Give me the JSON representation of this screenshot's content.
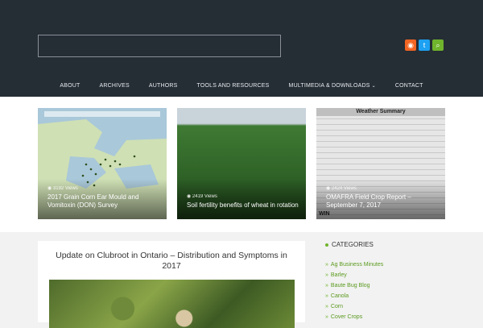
{
  "header": {
    "social": [
      {
        "name": "rss-icon",
        "glyph": "◉",
        "color": "#f26522"
      },
      {
        "name": "twitter-icon",
        "glyph": "t",
        "color": "#1da1f2"
      },
      {
        "name": "search-icon",
        "glyph": "⌕",
        "color": "#6fb42c"
      }
    ]
  },
  "nav": {
    "items": [
      "ABOUT",
      "ARCHIVES",
      "AUTHORS",
      "TOOLS AND RESOURCES",
      "MULTIMEDIA & DOWNLOADS",
      "CONTACT"
    ],
    "dropdown_glyph": "⌄"
  },
  "featured": [
    {
      "views": "3192 Views",
      "title": "2017 Grain Corn Ear Mould and Vomitoxin (DON) Survey"
    },
    {
      "views": "2419 Views",
      "title": "Soil fertility benefits of wheat in rotation"
    },
    {
      "views": "2424 Views",
      "title": "OMAFRA Field Crop Report – September 7, 2017",
      "table_title": "Weather Summary",
      "logo_text": "WIN"
    }
  ],
  "article": {
    "title": "Update on Clubroot in Ontario – Distribution and Symptoms in 2017"
  },
  "sidebar": {
    "heading": "CATEGORIES",
    "items": [
      "Ag Business Minutes",
      "Barley",
      "Baute Bug Blog",
      "Canola",
      "Corn",
      "Cover Crops"
    ]
  },
  "colors": {
    "header_bg": "#252d35",
    "accent": "#6fb42c"
  }
}
